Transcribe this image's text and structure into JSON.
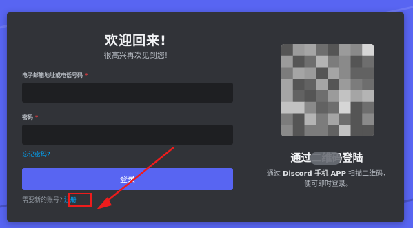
{
  "login": {
    "title": "欢迎回来!",
    "subtitle": "很高兴再次见到您!",
    "email_label": "电子邮箱地址或电话号码",
    "password_label": "密码",
    "required_mark": "*",
    "email_value": "",
    "password_value": "",
    "forgot_password": "忘记密码?",
    "login_button": "登录",
    "need_account": "需要新的账号?",
    "register_link": "注册"
  },
  "qr": {
    "title": "通过二维码登陆",
    "desc_prefix": "通过",
    "desc_bold": "Discord 手机 APP",
    "desc_suffix": "扫描二维码，便可即时登录。"
  },
  "colors": {
    "background": "#5865f2",
    "card": "#313338",
    "input": "#1e1f22",
    "accent": "#5865f2",
    "link": "#00a8fc",
    "annotation": "#ee1c1c"
  },
  "icons": {
    "arrow": "annotation-arrow-icon",
    "qr": "qr-code-icon"
  }
}
